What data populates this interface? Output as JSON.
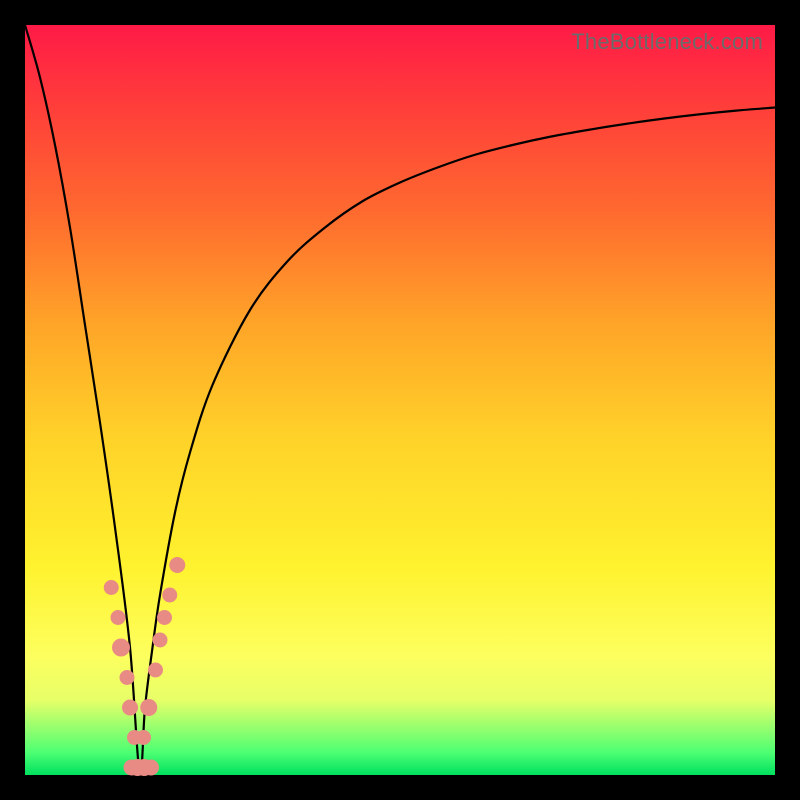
{
  "watermark": "TheBottleneck.com",
  "colors": {
    "frame_bg_top": "#ff1a47",
    "frame_bg_bottom": "#00e060",
    "curve": "#000000",
    "marker": "#e98b85",
    "page_bg": "#000000",
    "watermark": "#6b6b6b"
  },
  "chart_data": {
    "type": "line",
    "title": "",
    "xlabel": "",
    "ylabel": "",
    "xlim": [
      0,
      100
    ],
    "ylim": [
      0,
      100
    ],
    "grid": false,
    "legend": false,
    "series": [
      {
        "name": "bottleneck-curve",
        "x": [
          0,
          2,
          4,
          6,
          8,
          10,
          12,
          14,
          15.3,
          16,
          17,
          18,
          20,
          22,
          25,
          30,
          35,
          40,
          45,
          50,
          55,
          60,
          65,
          70,
          75,
          80,
          85,
          90,
          95,
          100
        ],
        "y": [
          100,
          93,
          84,
          73,
          60,
          47,
          33,
          17,
          0,
          9,
          17,
          24,
          35,
          43,
          52,
          62,
          68.5,
          73,
          76.5,
          79,
          81,
          82.7,
          84,
          85.1,
          86,
          86.8,
          87.5,
          88.1,
          88.6,
          89
        ]
      }
    ],
    "markers": {
      "name": "highlight-points",
      "x": [
        11.5,
        12.4,
        12.8,
        13.6,
        14.0,
        14.6,
        15.8,
        16.5,
        17.4,
        18.0,
        18.6,
        19.3,
        20.3,
        14.2,
        15.0,
        15.9,
        16.8
      ],
      "y": [
        25,
        21,
        17,
        13,
        9,
        5,
        5,
        9,
        14,
        18,
        21,
        24,
        28,
        1,
        1,
        1,
        1
      ],
      "r": [
        7.5,
        7.5,
        9,
        7.5,
        8,
        7.5,
        7.5,
        8.5,
        7.5,
        7.5,
        7.5,
        7.5,
        8,
        8,
        8.5,
        8.5,
        8
      ]
    }
  }
}
